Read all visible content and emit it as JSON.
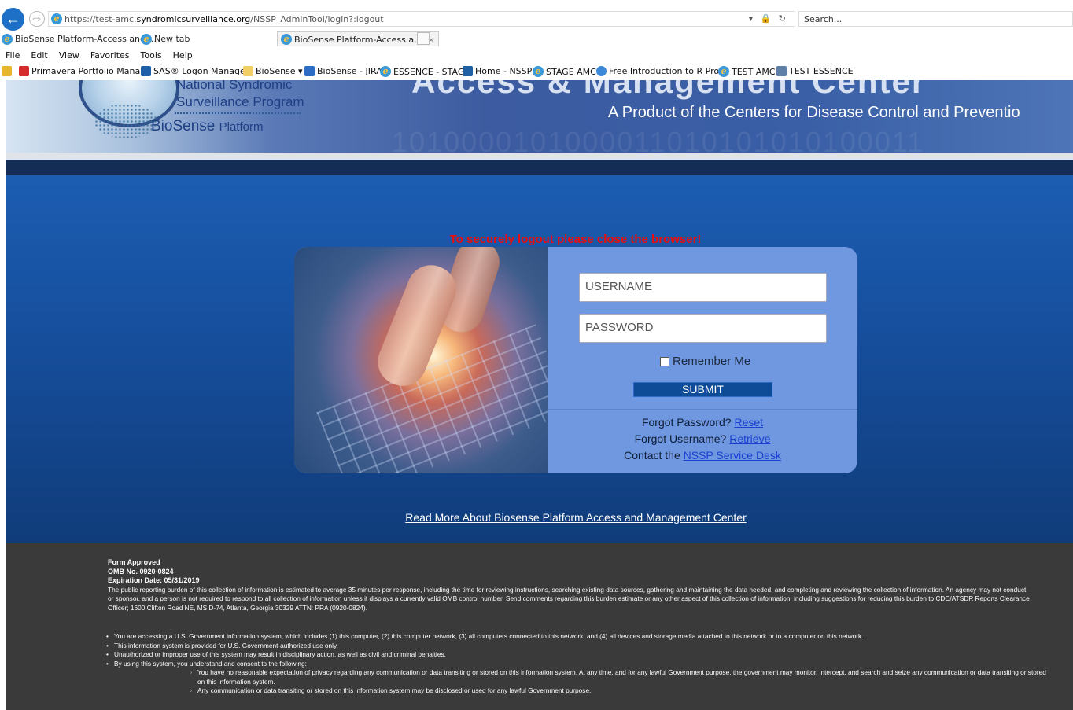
{
  "browser": {
    "url_prefix": "https://test-amc.",
    "url_host": "syndromicsurveillance.org",
    "url_path": "/NSSP_AdminTool/login?:logout",
    "url_tools": "▾ 🔒 ↻",
    "search_placeholder": "Search...",
    "tabs": [
      {
        "label": "BioSense Platform-Access and ..."
      },
      {
        "label": "New tab"
      },
      {
        "label": "BioSense Platform-Access a..."
      }
    ],
    "tab_close": "×",
    "menu": [
      "File",
      "Edit",
      "View",
      "Favorites",
      "Tools",
      "Help"
    ],
    "favorites": [
      "Primavera Portfolio Mana...",
      "SAS® Logon Manager",
      "BioSense ▾",
      "BioSense - JIRA",
      "ESSENCE - STAGE",
      "Home - NSSP",
      "STAGE AMC",
      "Free Introduction to R Pro...",
      "TEST AMC",
      "TEST ESSENCE"
    ]
  },
  "header": {
    "program_line1": "National Syndromic",
    "program_line2": "Surveillance Program",
    "logo_main": "BioSense",
    "logo_sub": "Platform",
    "title": "Access & Management Center",
    "product_line": "A Product of the Centers for Disease Control and Preventio",
    "binary": "1010000101000011010101010100011"
  },
  "login": {
    "logout_message": "To securely logout please close the browser!",
    "username_placeholder": "USERNAME",
    "password_placeholder": "PASSWORD",
    "remember_label": "Remember Me",
    "submit_label": "SUBMIT",
    "forgot_password_text": "Forgot Password?",
    "reset_link": "Reset",
    "forgot_username_text": "Forgot Username?",
    "retrieve_link": "Retrieve",
    "contact_text": "Contact the",
    "service_desk_link": "NSSP Service Desk"
  },
  "read_more": "Read More About Biosense Platform Access and Management Center",
  "footer": {
    "form_approved": "Form Approved",
    "omb": "OMB No. 0920-0824",
    "expiration": "Expiration Date: 05/31/2019",
    "burden_text": "The public reporting burden of this collection of information is estimated to average 35 minutes per response, including the time for reviewing instructions, searching existing data sources, gathering and maintaining the data needed, and completing and reviewing the collection of information. An agency may not conduct or sponsor, and a person is not required to respond to all collection of information unless it displays a currently valid OMB control number. Send comments regarding this burden estimate or any other aspect of this collection of information, including suggestions for reducing this burden to  CDC/ATSDR Reports Clearance Officer; 1600 Clifton Road NE, MS D-74, Atlanta, Georgia 30329 ATTN: PRA (0920-0824).",
    "notice_1": "You are accessing a U.S. Government information system, which includes (1) this computer, (2) this computer network, (3) all computers connected to this network, and (4) all devices and storage media attached to this network or to a computer on this network.",
    "notice_2": "This information system is provided for U.S. Government-authorized use only.",
    "notice_3": "Unauthorized or improper use of this system may result in disciplinary action, as well as civil and criminal penalties.",
    "notice_4": "By using this system, you understand and consent to the following:",
    "sub_1": "You have no reasonable expectation of privacy regarding any communication or data transiting or stored on this information system. At any time, and for any lawful Government purpose, the government may monitor, intercept, and search and seize any communication or data transiting or stored on this information system.",
    "sub_2": "Any communication or data transiting or stored on this information system may be disclosed or used for any lawful Government purpose."
  }
}
